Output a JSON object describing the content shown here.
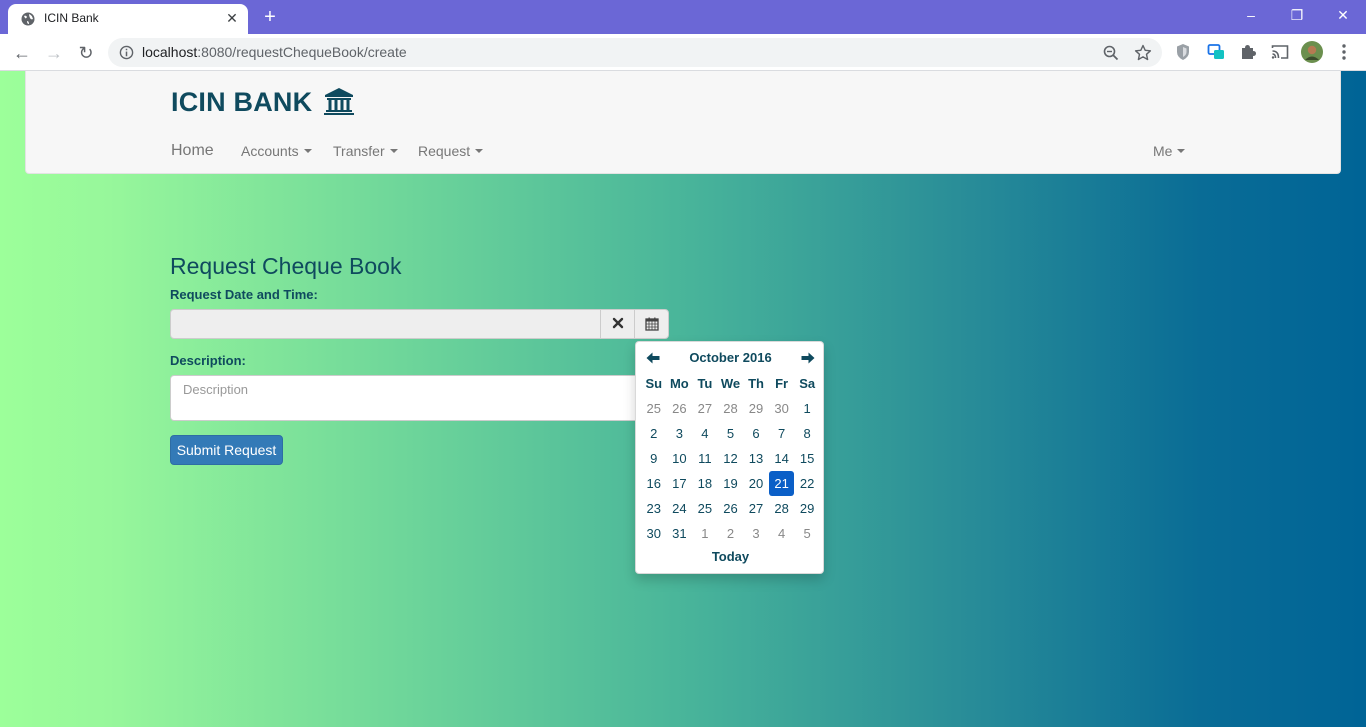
{
  "browser": {
    "tab_title": "ICIN Bank",
    "new_tab": "+",
    "url_host": "localhost",
    "url_rest": ":8080/requestChequeBook/create",
    "window": {
      "minimize": "–",
      "restore": "❐",
      "close": "✕"
    },
    "nav": {
      "back": "←",
      "forward": "→",
      "reload": "↻"
    }
  },
  "navbar": {
    "brand": "ICIN BANK",
    "home": "Home",
    "items": [
      "Accounts",
      "Transfer",
      "Request"
    ],
    "me": "Me"
  },
  "form": {
    "heading": "Request Cheque Book",
    "date_label": "Request Date and Time:",
    "date_value": "",
    "desc_label": "Description:",
    "desc_placeholder": "Description",
    "submit": "Submit Request"
  },
  "datepicker": {
    "month": "October 2016",
    "dow": [
      "Su",
      "Mo",
      "Tu",
      "We",
      "Th",
      "Fr",
      "Sa"
    ],
    "weeks": [
      [
        "25",
        "26",
        "27",
        "28",
        "29",
        "30",
        "1"
      ],
      [
        "2",
        "3",
        "4",
        "5",
        "6",
        "7",
        "8"
      ],
      [
        "9",
        "10",
        "11",
        "12",
        "13",
        "14",
        "15"
      ],
      [
        "16",
        "17",
        "18",
        "19",
        "20",
        "21",
        "22"
      ],
      [
        "23",
        "24",
        "25",
        "26",
        "27",
        "28",
        "29"
      ],
      [
        "30",
        "31",
        "1",
        "2",
        "3",
        "4",
        "5"
      ]
    ],
    "selected": "21",
    "today": "Today"
  },
  "colors": {
    "accent": "#0f4a5e",
    "button": "#337ab7",
    "selected": "#0b5fc7",
    "tabstrip": "#6b67d6"
  }
}
